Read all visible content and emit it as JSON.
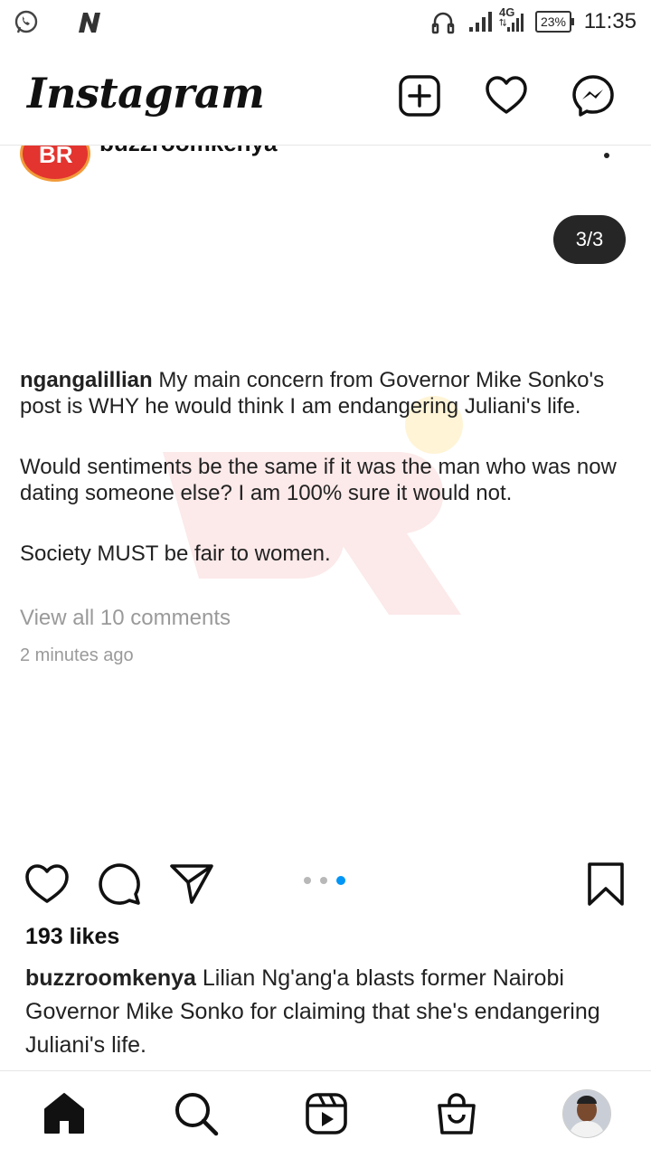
{
  "status_bar": {
    "time": "11:35",
    "battery": "23%",
    "network": "4G",
    "icons": [
      "whatsapp-icon",
      "news-n-icon",
      "headphones-icon",
      "signal-icon",
      "signal-4g-icon",
      "battery-icon"
    ]
  },
  "header": {
    "logo": "Instagram",
    "icons": [
      "new-post-icon",
      "heart-icon",
      "messenger-icon"
    ]
  },
  "post": {
    "author": "buzzroomkenya",
    "slide_counter": "3/3",
    "comment": {
      "username": "ngangalillian",
      "paragraph1": "My main concern from Governor Mike Sonko's post is WHY he would think I am endangering Juliani's life.",
      "paragraph2": "Would sentiments be the same if it was the man who was now dating someone else? I am 100% sure it would not.",
      "paragraph3": "Society MUST be fair to women."
    },
    "view_all_comments": "View all 10 comments",
    "time_ago": "2 minutes ago",
    "carousel": {
      "total": 3,
      "active": 3
    },
    "likes": "193 likes",
    "caption": {
      "username": "buzzroomkenya",
      "text": "Lilian Ng'ang'a blasts former Nairobi Governor Mike Sonko for claiming that she's endangering Juliani's life."
    }
  },
  "bottom_nav": {
    "items": [
      "home-icon",
      "search-icon",
      "reels-icon",
      "shop-icon",
      "profile-avatar"
    ]
  },
  "colors": {
    "accent_blue": "#0095f6",
    "watermark_red": "#e3342f",
    "text_gray": "#9a9a9a"
  }
}
